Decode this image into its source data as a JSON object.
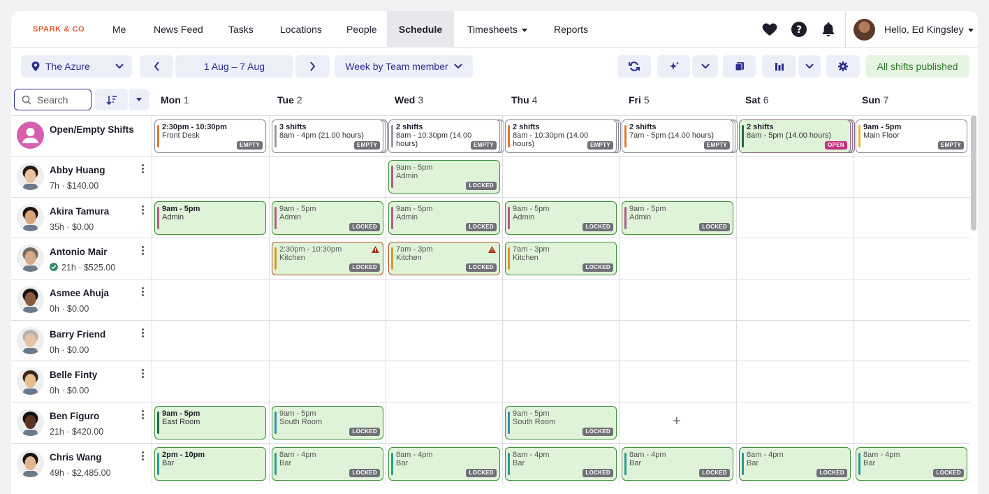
{
  "brand": "SPARK & CO",
  "nav": {
    "items": [
      "Me",
      "News Feed",
      "Tasks",
      "Locations",
      "People",
      "Schedule",
      "Timesheets",
      "Reports"
    ],
    "active": "Schedule",
    "greeting": "Hello, Ed Kingsley"
  },
  "toolbar": {
    "location": "The Azure",
    "date_range": "1 Aug – 7 Aug",
    "view": "Week by Team member",
    "published": "All shifts published"
  },
  "search": {
    "placeholder": "Search"
  },
  "days": [
    {
      "name": "Mon",
      "num": "1"
    },
    {
      "name": "Tue",
      "num": "2"
    },
    {
      "name": "Wed",
      "num": "3"
    },
    {
      "name": "Thu",
      "num": "4"
    },
    {
      "name": "Fri",
      "num": "5"
    },
    {
      "name": "Sat",
      "num": "6"
    },
    {
      "name": "Sun",
      "num": "7"
    }
  ],
  "open_row": {
    "label": "Open/Empty Shifts",
    "shifts": [
      {
        "day": 0,
        "line1": "2:30pm - 10:30pm",
        "line2": "Front Desk",
        "badge": "EMPTY",
        "color": "#e07a2e",
        "stack": false
      },
      {
        "day": 1,
        "line1": "3 shifts",
        "line2": "8am - 4pm (21.00 hours)",
        "badge": "EMPTY",
        "color": "#9a9aa2",
        "stack": true
      },
      {
        "day": 2,
        "line1": "2 shifts",
        "line2": "8am - 10:30pm (14.00 hours)",
        "badge": "EMPTY",
        "color": "#9a9aa2",
        "stack": true
      },
      {
        "day": 3,
        "line1": "2 shifts",
        "line2": "8am - 10:30pm (14.00 hours)",
        "badge": "EMPTY",
        "color": "#e07a2e",
        "stack": true
      },
      {
        "day": 4,
        "line1": "2 shifts",
        "line2": "7am - 5pm (14.00 hours)",
        "badge": "EMPTY",
        "color": "#e07a2e",
        "stack": true
      },
      {
        "day": 5,
        "line1": "2 shifts",
        "line2": "8am - 5pm (14.00 hours)",
        "badge": "OPEN",
        "color": "#1f6b52",
        "stack": true,
        "open": true
      },
      {
        "day": 6,
        "line1": "9am - 5pm",
        "line2": "Main Floor",
        "badge": "EMPTY",
        "color": "#e8b93a",
        "stack": false
      }
    ]
  },
  "people": [
    {
      "name": "Abby Huang",
      "sub": "7h · $140.00",
      "shifts": [
        {
          "day": 2,
          "line1": "9am - 5pm",
          "line2": "Admin",
          "badge": "LOCKED",
          "color": "#b05a8a"
        }
      ]
    },
    {
      "name": "Akira Tamura",
      "sub": "35h · $0.00",
      "shifts": [
        {
          "day": 0,
          "line1": "9am - 5pm",
          "line2": "Admin",
          "color": "#b05a8a"
        },
        {
          "day": 1,
          "line1": "9am - 5pm",
          "line2": "Admin",
          "badge": "LOCKED",
          "color": "#b05a8a"
        },
        {
          "day": 2,
          "line1": "9am - 5pm",
          "line2": "Admin",
          "badge": "LOCKED",
          "color": "#b05a8a"
        },
        {
          "day": 3,
          "line1": "9am - 5pm",
          "line2": "Admin",
          "badge": "LOCKED",
          "color": "#b05a8a"
        },
        {
          "day": 4,
          "line1": "9am - 5pm",
          "line2": "Admin",
          "badge": "LOCKED",
          "color": "#b05a8a"
        }
      ]
    },
    {
      "name": "Antonio Mair",
      "sub": "21h · $525.00",
      "verified": true,
      "shifts": [
        {
          "day": 1,
          "line1": "2:30pm - 10:30pm",
          "line2": "Kitchen",
          "badge": "LOCKED",
          "color": "#d99a2a",
          "warn": true
        },
        {
          "day": 2,
          "line1": "7am - 3pm",
          "line2": "Kitchen",
          "badge": "LOCKED",
          "color": "#d99a2a",
          "warn": true
        },
        {
          "day": 3,
          "line1": "7am - 3pm",
          "line2": "Kitchen",
          "badge": "LOCKED",
          "color": "#d99a2a"
        }
      ]
    },
    {
      "name": "Asmee Ahuja",
      "sub": "0h · $0.00",
      "shifts": []
    },
    {
      "name": "Barry Friend",
      "sub": "0h · $0.00",
      "shifts": []
    },
    {
      "name": "Belle Finty",
      "sub": "0h · $0.00",
      "shifts": []
    },
    {
      "name": "Ben Figuro",
      "sub": "21h · $420.00",
      "shifts": [
        {
          "day": 0,
          "line1": "9am - 5pm",
          "line2": "East Room",
          "color": "#1f6b52"
        },
        {
          "day": 1,
          "line1": "9am - 5pm",
          "line2": "South Room",
          "badge": "LOCKED",
          "color": "#3a8fb0"
        },
        {
          "day": 3,
          "line1": "9am - 5pm",
          "line2": "South Room",
          "badge": "LOCKED",
          "color": "#3a8fb0"
        }
      ],
      "plus_day": 4,
      "plus": "+"
    },
    {
      "name": "Chris Wang",
      "sub": "49h · $2,485.00",
      "shifts": [
        {
          "day": 0,
          "line1": "2pm - 10pm",
          "line2": "Bar",
          "color": "#2a9a9a"
        },
        {
          "day": 1,
          "line1": "8am - 4pm",
          "line2": "Bar",
          "badge": "LOCKED",
          "color": "#2a9a9a"
        },
        {
          "day": 2,
          "line1": "8am - 4pm",
          "line2": "Bar",
          "badge": "LOCKED",
          "color": "#2a9a9a"
        },
        {
          "day": 3,
          "line1": "8am - 4pm",
          "line2": "Bar",
          "badge": "LOCKED",
          "color": "#2a9a9a"
        },
        {
          "day": 4,
          "line1": "8am - 4pm",
          "line2": "Bar",
          "badge": "LOCKED",
          "color": "#2a9a9a"
        },
        {
          "day": 5,
          "line1": "8am - 4pm",
          "line2": "Bar",
          "badge": "LOCKED",
          "color": "#2a9a9a"
        },
        {
          "day": 6,
          "line1": "8am - 4pm",
          "line2": "Bar",
          "badge": "LOCKED",
          "color": "#2a9a9a"
        }
      ]
    }
  ]
}
